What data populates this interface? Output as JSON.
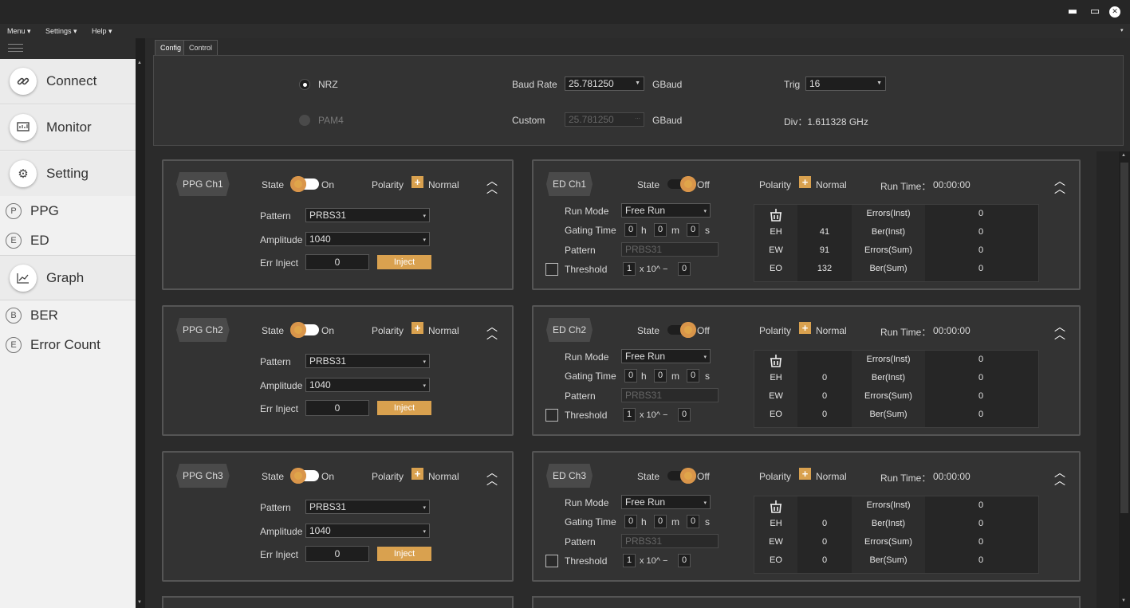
{
  "menu": {
    "menu": "Menu ▾",
    "settings": "Settings ▾",
    "help": "Help ▾"
  },
  "window": {
    "minimize": "▬",
    "maximize": "▭",
    "close": "✕"
  },
  "sidebar": {
    "connect": "Connect",
    "monitor": "Monitor",
    "setting": "Setting",
    "ppg_badge": "P",
    "ppg": "PPG",
    "ed_badge": "E",
    "ed": "ED",
    "graph": "Graph",
    "ber_badge": "B",
    "ber": "BER",
    "errcount_badge": "E",
    "errcount": "Error Count"
  },
  "tabs": {
    "config": "Config",
    "control": "Control"
  },
  "config": {
    "nrz": "NRZ",
    "pam4": "PAM4",
    "baud_label": "Baud Rate",
    "baud_value": "25.781250",
    "baud_unit": "GBaud",
    "custom_label": "Custom",
    "custom_value": "25.781250",
    "custom_unit": "GBaud",
    "trig_label": "Trig",
    "trig_value": "16",
    "div_label": "Div：1.611328 GHz",
    "selected_mode": "NRZ"
  },
  "ppg": [
    {
      "name": "PPG Ch1",
      "state_label": "State",
      "state": "On",
      "polarity_label": "Polarity",
      "polarity": "Normal",
      "pattern_label": "Pattern",
      "pattern": "PRBS31",
      "amplitude_label": "Amplitude",
      "amplitude": "1040",
      "errinject_label": "Err Inject",
      "errinject": "0",
      "inject": "Inject"
    },
    {
      "name": "PPG Ch2",
      "state_label": "State",
      "state": "On",
      "polarity_label": "Polarity",
      "polarity": "Normal",
      "pattern_label": "Pattern",
      "pattern": "PRBS31",
      "amplitude_label": "Amplitude",
      "amplitude": "1040",
      "errinject_label": "Err Inject",
      "errinject": "0",
      "inject": "Inject"
    },
    {
      "name": "PPG Ch3",
      "state_label": "State",
      "state": "On",
      "polarity_label": "Polarity",
      "polarity": "Normal",
      "pattern_label": "Pattern",
      "pattern": "PRBS31",
      "amplitude_label": "Amplitude",
      "amplitude": "1040",
      "errinject_label": "Err Inject",
      "errinject": "0",
      "inject": "Inject"
    }
  ],
  "ed": [
    {
      "name": "ED Ch1",
      "state_label": "State",
      "state": "Off",
      "polarity_label": "Polarity",
      "polarity": "Normal",
      "runtime_label": "Run Time：",
      "runtime": "00:00:00",
      "runmode_label": "Run Mode",
      "runmode": "Free Run",
      "gating_label": "Gating Time",
      "g_h": "0",
      "h": "h",
      "g_m": "0",
      "m": "m",
      "g_s": "0",
      "s": "s",
      "pattern_label": "Pattern",
      "pattern": "PRBS31",
      "threshold_label": "Threshold",
      "th_mant": "1",
      "th_x": "x 10^ −",
      "th_exp": "0",
      "eh_label": "EH",
      "eh": "41",
      "ew_label": "EW",
      "ew": "91",
      "eo_label": "EO",
      "eo": "132",
      "err_inst_label": "Errors(Inst)",
      "err_inst": "0",
      "ber_inst_label": "Ber(Inst)",
      "ber_inst": "0",
      "err_sum_label": "Errors(Sum)",
      "err_sum": "0",
      "ber_sum_label": "Ber(Sum)",
      "ber_sum": "0"
    },
    {
      "name": "ED Ch2",
      "state_label": "State",
      "state": "Off",
      "polarity_label": "Polarity",
      "polarity": "Normal",
      "runtime_label": "Run Time：",
      "runtime": "00:00:00",
      "runmode_label": "Run Mode",
      "runmode": "Free Run",
      "gating_label": "Gating Time",
      "g_h": "0",
      "h": "h",
      "g_m": "0",
      "m": "m",
      "g_s": "0",
      "s": "s",
      "pattern_label": "Pattern",
      "pattern": "PRBS31",
      "threshold_label": "Threshold",
      "th_mant": "1",
      "th_x": "x 10^ −",
      "th_exp": "0",
      "eh_label": "EH",
      "eh": "0",
      "ew_label": "EW",
      "ew": "0",
      "eo_label": "EO",
      "eo": "0",
      "err_inst_label": "Errors(Inst)",
      "err_inst": "0",
      "ber_inst_label": "Ber(Inst)",
      "ber_inst": "0",
      "err_sum_label": "Errors(Sum)",
      "err_sum": "0",
      "ber_sum_label": "Ber(Sum)",
      "ber_sum": "0"
    },
    {
      "name": "ED Ch3",
      "state_label": "State",
      "state": "Off",
      "polarity_label": "Polarity",
      "polarity": "Normal",
      "runtime_label": "Run Time：",
      "runtime": "00:00:00",
      "runmode_label": "Run Mode",
      "runmode": "Free Run",
      "gating_label": "Gating Time",
      "g_h": "0",
      "h": "h",
      "g_m": "0",
      "m": "m",
      "g_s": "0",
      "s": "s",
      "pattern_label": "Pattern",
      "pattern": "PRBS31",
      "threshold_label": "Threshold",
      "th_mant": "1",
      "th_x": "x 10^ −",
      "th_exp": "0",
      "eh_label": "EH",
      "eh": "0",
      "ew_label": "EW",
      "ew": "0",
      "eo_label": "EO",
      "eo": "0",
      "err_inst_label": "Errors(Inst)",
      "err_inst": "0",
      "ber_inst_label": "Ber(Inst)",
      "ber_inst": "0",
      "err_sum_label": "Errors(Sum)",
      "err_sum": "0",
      "ber_sum_label": "Ber(Sum)",
      "ber_sum": "0"
    }
  ],
  "colors": {
    "accent": "#d9a14f",
    "background": "#2b2b2b",
    "panel": "#333333",
    "sidebar": "#f1f1f1"
  }
}
